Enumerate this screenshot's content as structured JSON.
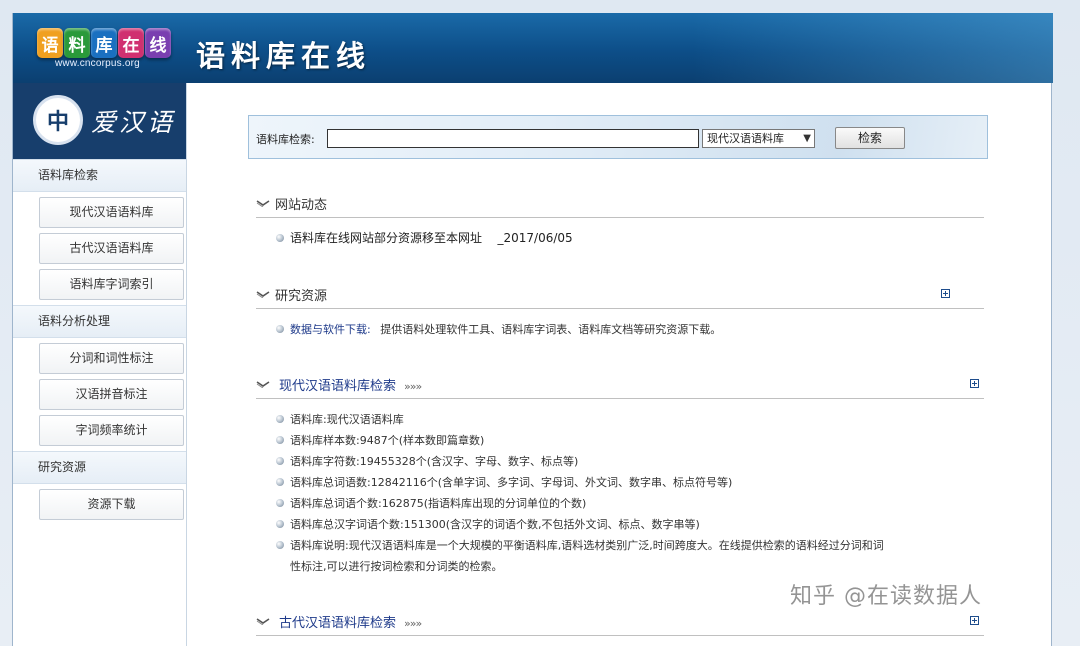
{
  "banner": {
    "logo_chars": [
      "语",
      "料",
      "库",
      "在",
      "线"
    ],
    "logo_colors": [
      "#f0a020",
      "#2a9a3a",
      "#1a70c0",
      "#d03070",
      "#7a3fb0"
    ],
    "logo_url": "www.cncorpus.org",
    "title": "语料库在线"
  },
  "sidebar": {
    "logo_text": "爱汉语",
    "logo_seal": "中",
    "sections": [
      {
        "label": "语料库检索",
        "items": [
          "现代汉语语料库",
          "古代汉语语料库",
          "语料库字词索引"
        ]
      },
      {
        "label": "语料分析处理",
        "items": [
          "分词和词性标注",
          "汉语拼音标注",
          "字词频率统计"
        ]
      },
      {
        "label": "研究资源",
        "items": [
          "资源下载"
        ]
      }
    ]
  },
  "search": {
    "label": "语料库检索:",
    "query": "",
    "corpus_selected": "现代汉语语料库",
    "button_label": "检索"
  },
  "news": {
    "title": "网站动态",
    "items": [
      {
        "text": "语料库在线网站部分资源移至本网址",
        "date": "_2017/06/05"
      }
    ]
  },
  "resources": {
    "title": "研究资源",
    "link_text": "数据与软件下载:",
    "description": "提供语料处理软件工具、语料库字词表、语料库文档等研究资源下载。"
  },
  "modern": {
    "title": "现代汉语语料库检索",
    "arrows": "»»»",
    "items": [
      "语料库:现代汉语语料库",
      "语料库样本数:9487个(样本数即篇章数)",
      "语料库字符数:19455328个(含汉字、字母、数字、标点等)",
      "语料库总词语数:12842116个(含单字词、多字词、字母词、外文词、数字串、标点符号等)",
      "语料库总词语个数:162875(指语料库出现的分词单位的个数)",
      "语料库总汉字词语个数:151300(含汉字的词语个数,不包括外文词、标点、数字串等)"
    ],
    "description_line1": "语料库说明:现代汉语语料库是一个大规模的平衡语料库,语料选材类别广泛,时间跨度大。在线提供检索的语料经过分词和词",
    "description_line2": "性标注,可以进行按词检索和分词类的检索。"
  },
  "ancient": {
    "title": "古代汉语语料库检索",
    "arrows": "»»»"
  },
  "watermark": "知乎 @在读数据人"
}
